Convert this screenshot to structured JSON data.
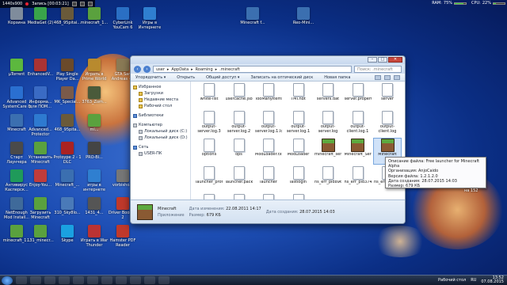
{
  "recorder": {
    "resolution": "1440x900",
    "status": "Запись [00:03:21]"
  },
  "system_monitor": {
    "ram_label": "RAM:",
    "ram_value": "75%",
    "ram_fraction": 0.75,
    "cpu_label": "CPU:",
    "cpu_value": "22%",
    "cpu_fraction": 0.22
  },
  "desktop_icons": [
    {
      "label": "Корзина",
      "color": "#7f8c9c"
    },
    {
      "label": "MediaGet (2)",
      "color": "#39a44a"
    },
    {
      "label": "468_95pitai...",
      "color": "#6a5a3a"
    },
    {
      "label": "minecraft_1...",
      "color": "#5aa13e"
    },
    {
      "label": "CyberLink YouCam 6",
      "color": "#2a6fc4"
    },
    {
      "label": "Игры в Интернете",
      "color": "#2f7fd0"
    },
    {
      "label": "Minecraft f...",
      "color": "#3b6fb0"
    },
    {
      "label": "Reo-Mini...",
      "color": "#3b6fb0"
    },
    {
      "label": "µTorrent",
      "color": "#5cb83e"
    },
    {
      "label": "EnhancedV...",
      "color": "#a33"
    },
    {
      "label": "Play Single Player Da...",
      "color": "#6b4a2a"
    },
    {
      "label": "Играть в Prime World",
      "color": "#b88a2e"
    },
    {
      "label": "GTA San Andreas -...",
      "color": "#8a7a55"
    },
    {
      "label": "Advanced SystemCare 8",
      "color": "#2a6fd0"
    },
    {
      "label": "Информа... для ПОМ...",
      "color": "#3a6bc4"
    },
    {
      "label": "MK_Special...",
      "color": "#7a5a4a"
    },
    {
      "label": "3763_Zom...",
      "color": "#4a5a3a"
    },
    {
      "label": "Minecraft",
      "color": "#3b6fb0"
    },
    {
      "label": "Advanced... Protector",
      "color": "#2e7ad0"
    },
    {
      "label": "468_95pita...",
      "color": "#6a5a3a"
    },
    {
      "label": "mi...",
      "color": "#5aa13e"
    },
    {
      "label": "Старт Лаунчера",
      "color": "#4a4a4a"
    },
    {
      "label": "Установить Minecraft",
      "color": "#5aa13e"
    },
    {
      "label": "Protoype 2 - 1 DLC",
      "color": "#a22"
    },
    {
      "label": "PRO-Bl...",
      "color": "#444"
    },
    {
      "label": "Антивирус Касперск...",
      "color": "#1f9a5a"
    },
    {
      "label": "Enjoy-You...",
      "color": "#c03c3c"
    },
    {
      "label": "Minecraft_...",
      "color": "#3b6fb0"
    },
    {
      "label": "игры в интернете",
      "color": "#2f7fd0"
    },
    {
      "label": "vorbisho...",
      "color": "#777"
    },
    {
      "label": "NetEnough Mod Install...",
      "color": "#3f6a9a"
    },
    {
      "label": "Загрузить Minecraft",
      "color": "#5aa13e"
    },
    {
      "label": "310_Sky8lo...",
      "color": "#4a7ab8"
    },
    {
      "label": "1431_4...",
      "color": "#555"
    },
    {
      "label": "Driver Booster 2",
      "color": "#c0392b"
    },
    {
      "label": "minecraft_1...",
      "color": "#5aa13e"
    },
    {
      "label": "131_minecr...",
      "color": "#5aa13e"
    },
    {
      "label": "Skype",
      "color": "#1aa1e1"
    },
    {
      "label": "Играть в War Thunder",
      "color": "#b33"
    },
    {
      "label": "Hamster PDF Reader",
      "color": "#c0392b"
    }
  ],
  "explorer": {
    "address": [
      "user",
      "AppData",
      "Roaming",
      ".minecraft"
    ],
    "search_placeholder": "Поиск: .minecraft",
    "toolbar": {
      "organize": "Упорядочить ▾",
      "open": "Открыть",
      "share": "Общий доступ ▾",
      "burn": "Записать на оптический диск",
      "new_folder": "Новая папка"
    },
    "nav": [
      {
        "label": "Избранное",
        "kind": "star",
        "sub": false
      },
      {
        "label": "Загрузки",
        "kind": "folder",
        "sub": true
      },
      {
        "label": "Недавние места",
        "kind": "folder",
        "sub": true
      },
      {
        "label": "Рабочий стол",
        "kind": "folder",
        "sub": true
      },
      {
        "label": "Библиотеки",
        "kind": "blue",
        "sub": false
      },
      {
        "label": "Компьютер",
        "kind": "grey",
        "sub": false
      },
      {
        "label": "Локальный диск (C:)",
        "kind": "grey",
        "sub": true
      },
      {
        "label": "Локальный диск (D:)",
        "kind": "grey",
        "sub": true
      },
      {
        "label": "Сеть",
        "kind": "blue",
        "sub": false
      },
      {
        "label": "USER-ПК",
        "kind": "grey",
        "sub": true
      }
    ],
    "files": [
      {
        "name": "white-list",
        "type": "doc"
      },
      {
        "name": "usercache.json",
        "type": "doc"
      },
      {
        "name": "TooManyItems",
        "type": "doc"
      },
      {
        "name": "TMI.nbt",
        "type": "doc"
      },
      {
        "name": "servers.dat",
        "type": "doc"
      },
      {
        "name": "server.properties",
        "type": "doc"
      },
      {
        "name": "server",
        "type": "doc"
      },
      {
        "name": "output-server.log.3",
        "type": "doc"
      },
      {
        "name": "output-server.log.2",
        "type": "doc"
      },
      {
        "name": "output-server.log.1.lck",
        "type": "doc"
      },
      {
        "name": "output-server.log.1",
        "type": "doc"
      },
      {
        "name": "output-server.log",
        "type": "doc"
      },
      {
        "name": "output-client.log.1",
        "type": "doc"
      },
      {
        "name": "output-client.log",
        "type": "doc"
      },
      {
        "name": "options",
        "type": "doc"
      },
      {
        "name": "ops",
        "type": "doc"
      },
      {
        "name": "ModLoader.txt.1",
        "type": "doc"
      },
      {
        "name": "ModLoader",
        "type": "doc"
      },
      {
        "name": "minecraft_server",
        "type": "mc"
      },
      {
        "name": "Minecraft_Server",
        "type": "mc"
      },
      {
        "name": "Minecraft",
        "type": "mc",
        "selected": true
      },
      {
        "name": "launcher_profiles.json",
        "type": "doc"
      },
      {
        "name": "launcher.pack.lzma",
        "type": "doc"
      },
      {
        "name": "launcher",
        "type": "doc"
      },
      {
        "name": "lastlogin",
        "type": "doc"
      },
      {
        "name": "hs_err_pid896",
        "type": "doc"
      },
      {
        "name": "hs_err_pid3740",
        "type": "doc"
      },
      {
        "name": "hs_err_pid3064",
        "type": "doc"
      },
      {
        "name": "hs_err_pid...",
        "type": "doc"
      },
      {
        "name": "hs_err_pid...",
        "type": "doc"
      },
      {
        "name": "hs_err_pid...",
        "type": "doc"
      },
      {
        "name": "hs_err_pid...",
        "type": "doc"
      }
    ],
    "details": {
      "name": "Minecraft",
      "kind": "Приложение",
      "modified_label": "Дата изменения:",
      "modified": "22.08.2011 14:17",
      "size_label": "Размер:",
      "size": "679 КБ",
      "created_label": "Дата создания:",
      "created": "28.07.2015 14:03"
    }
  },
  "tooltip": {
    "lines": [
      "Описание файла: Free launcher for Minecraft Alpha",
      "Организация: AnjoCaido",
      "Версия файла: 1.2.1.2.0",
      "Дата создания: 28.07.2015 14:03",
      "Размер: 679 КБ"
    ]
  },
  "desktop_extra_label": "на 152",
  "taskbar": {
    "desktop_label": "Рабочий стол",
    "lang": "RU",
    "time": "13:52",
    "date": "07.08.2015"
  }
}
